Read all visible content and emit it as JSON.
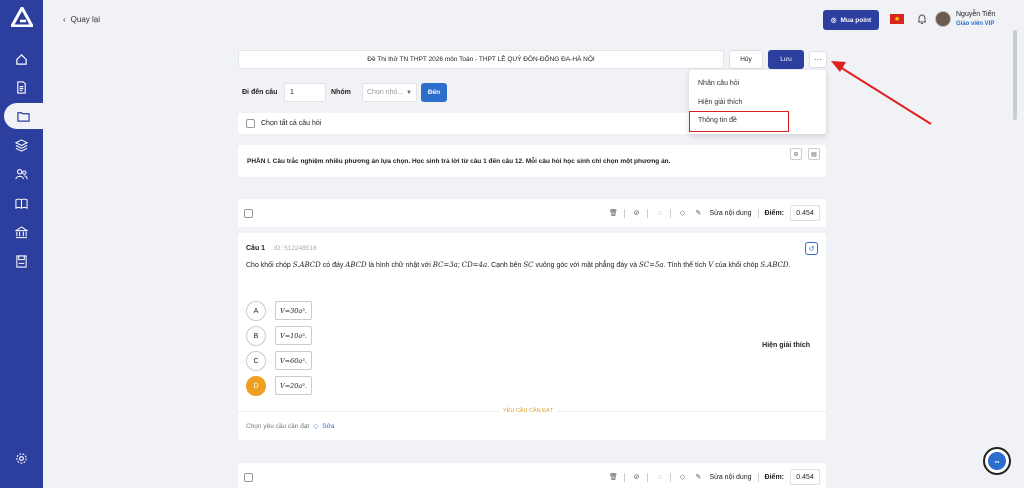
{
  "header": {
    "back_label": "Quay lại",
    "buy_label": "Mua point",
    "user_name": "Nguyễn Tiến",
    "user_role": "Giáo viên VIP"
  },
  "sidebar": {
    "items": [
      {
        "name": "home-icon"
      },
      {
        "name": "document-icon"
      },
      {
        "name": "folder-icon"
      },
      {
        "name": "layers-icon"
      },
      {
        "name": "users-icon"
      },
      {
        "name": "book-icon"
      },
      {
        "name": "bank-icon"
      },
      {
        "name": "save-icon"
      }
    ],
    "active_index": 2
  },
  "toolbar": {
    "exam_title": "Đề Thi thử TN THPT 2026 môn Toán - THPT LÊ QUÝ ĐÔN-ĐỐNG ĐA-HÀ NỘI",
    "cancel_label": "Hủy",
    "save_label": "Lưu",
    "more_label": "···"
  },
  "goto": {
    "label": "Đi đến câu",
    "value": "1",
    "group_label": "Nhóm",
    "group_placeholder": "Chọn nhó...",
    "go_label": "Đến"
  },
  "select_all_label": "Chọn tất cả câu hỏi",
  "menu": {
    "items": [
      "Nhân câu hỏi",
      "Hiện giải thích",
      "Thông tin đề"
    ],
    "highlighted": "Thông tin đề"
  },
  "part": {
    "text": "PHẦN I. Câu trắc nghiệm nhiều phương án lựa chọn. Học sinh trả lời từ câu 1 đến câu 12. Mỗi câu hỏi học sinh chỉ chọn một phương án."
  },
  "question": {
    "number_label": "Câu  1",
    "id_label": "ID: 512248516",
    "text_html_parts": {
      "p1": "Cho khối chóp ",
      "m1": "S.ABCD",
      "p2": " có đáy ",
      "m2": "ABCD",
      "p3": " là hình chữ nhật với ",
      "m3": "BC=3a",
      "p4": "; ",
      "m4": "CD=4a",
      "p5": ". Cạnh bên ",
      "m5": "SC",
      "p6": " vuông góc với mặt phẳng đáy và ",
      "m6": "SC=5a",
      "p7": ". Tính thể tích ",
      "m7": "V",
      "p8": " của khối chóp ",
      "m8": "S.ABCD",
      "p9": "."
    },
    "options": [
      {
        "letter": "A",
        "value": "V=30a³."
      },
      {
        "letter": "B",
        "value": "V=10a³."
      },
      {
        "letter": "C",
        "value": "V=60a³."
      },
      {
        "letter": "D",
        "value": "V=20a³."
      }
    ],
    "correct": "D",
    "explain_label": "Hiện giải thích",
    "requirement_label": "YÊU CẦU CẦN ĐẠT",
    "requirement_choose": "Chọn yêu cầu cần đạt",
    "requirement_edit": "Sửa"
  },
  "question_tools": {
    "edit_label": "Sửa nội dung",
    "score_label": "Điểm:",
    "score_value": "0.454"
  },
  "colors": {
    "primary": "#2c3f9e",
    "accent": "#2c6ecb",
    "correct": "#f0a020",
    "highlight": "#e02020"
  }
}
